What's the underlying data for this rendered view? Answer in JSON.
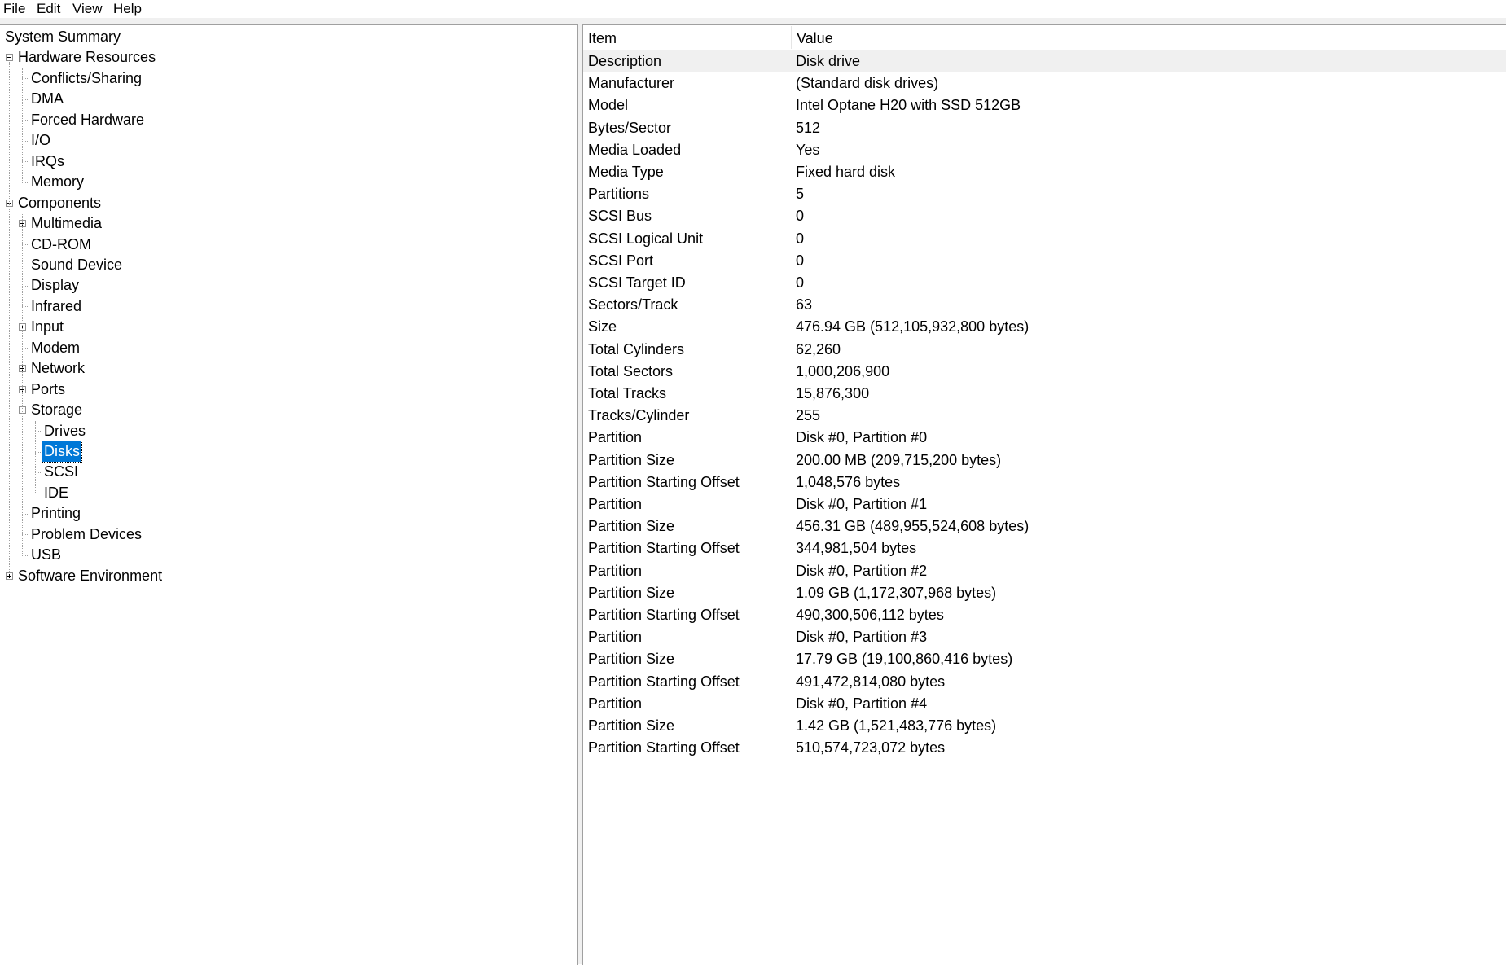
{
  "menu": [
    "File",
    "Edit",
    "View",
    "Help"
  ],
  "tree": [
    {
      "label": "System Summary",
      "level": 0,
      "expander": null
    },
    {
      "label": "Hardware Resources",
      "level": 1,
      "expander": "minus"
    },
    {
      "label": "Conflicts/Sharing",
      "level": 2,
      "expander": null
    },
    {
      "label": "DMA",
      "level": 2,
      "expander": null
    },
    {
      "label": "Forced Hardware",
      "level": 2,
      "expander": null
    },
    {
      "label": "I/O",
      "level": 2,
      "expander": null
    },
    {
      "label": "IRQs",
      "level": 2,
      "expander": null
    },
    {
      "label": "Memory",
      "level": 2,
      "expander": null
    },
    {
      "label": "Components",
      "level": 1,
      "expander": "minus"
    },
    {
      "label": "Multimedia",
      "level": 2,
      "expander": "plus"
    },
    {
      "label": "CD-ROM",
      "level": 2,
      "expander": null
    },
    {
      "label": "Sound Device",
      "level": 2,
      "expander": null
    },
    {
      "label": "Display",
      "level": 2,
      "expander": null
    },
    {
      "label": "Infrared",
      "level": 2,
      "expander": null
    },
    {
      "label": "Input",
      "level": 2,
      "expander": "plus"
    },
    {
      "label": "Modem",
      "level": 2,
      "expander": null
    },
    {
      "label": "Network",
      "level": 2,
      "expander": "plus"
    },
    {
      "label": "Ports",
      "level": 2,
      "expander": "plus"
    },
    {
      "label": "Storage",
      "level": 2,
      "expander": "minus"
    },
    {
      "label": "Drives",
      "level": 3,
      "expander": null
    },
    {
      "label": "Disks",
      "level": 3,
      "expander": null,
      "selected": true
    },
    {
      "label": "SCSI",
      "level": 3,
      "expander": null
    },
    {
      "label": "IDE",
      "level": 3,
      "expander": null
    },
    {
      "label": "Printing",
      "level": 2,
      "expander": null
    },
    {
      "label": "Problem Devices",
      "level": 2,
      "expander": null
    },
    {
      "label": "USB",
      "level": 2,
      "expander": null
    },
    {
      "label": "Software Environment",
      "level": 1,
      "expander": "plus"
    }
  ],
  "list": {
    "columns": [
      "Item",
      "Value"
    ],
    "rows": [
      [
        "Description",
        "Disk drive"
      ],
      [
        "Manufacturer",
        "(Standard disk drives)"
      ],
      [
        "Model",
        "Intel Optane H20 with SSD 512GB"
      ],
      [
        "Bytes/Sector",
        "512"
      ],
      [
        "Media Loaded",
        "Yes"
      ],
      [
        "Media Type",
        "Fixed hard disk"
      ],
      [
        "Partitions",
        "5"
      ],
      [
        "SCSI Bus",
        "0"
      ],
      [
        "SCSI Logical Unit",
        "0"
      ],
      [
        "SCSI Port",
        "0"
      ],
      [
        "SCSI Target ID",
        "0"
      ],
      [
        "Sectors/Track",
        "63"
      ],
      [
        "Size",
        "476.94 GB (512,105,932,800 bytes)"
      ],
      [
        "Total Cylinders",
        "62,260"
      ],
      [
        "Total Sectors",
        "1,000,206,900"
      ],
      [
        "Total Tracks",
        "15,876,300"
      ],
      [
        "Tracks/Cylinder",
        "255"
      ],
      [
        "Partition",
        "Disk #0, Partition #0"
      ],
      [
        "Partition Size",
        "200.00 MB (209,715,200 bytes)"
      ],
      [
        "Partition Starting Offset",
        "1,048,576 bytes"
      ],
      [
        "Partition",
        "Disk #0, Partition #1"
      ],
      [
        "Partition Size",
        "456.31 GB (489,955,524,608 bytes)"
      ],
      [
        "Partition Starting Offset",
        "344,981,504 bytes"
      ],
      [
        "Partition",
        "Disk #0, Partition #2"
      ],
      [
        "Partition Size",
        "1.09 GB (1,172,307,968 bytes)"
      ],
      [
        "Partition Starting Offset",
        "490,300,506,112 bytes"
      ],
      [
        "Partition",
        "Disk #0, Partition #3"
      ],
      [
        "Partition Size",
        "17.79 GB (19,100,860,416 bytes)"
      ],
      [
        "Partition Starting Offset",
        "491,472,814,080 bytes"
      ],
      [
        "Partition",
        "Disk #0, Partition #4"
      ],
      [
        "Partition Size",
        "1.42 GB (1,521,483,776 bytes)"
      ],
      [
        "Partition Starting Offset",
        "510,574,723,072 bytes"
      ]
    ],
    "highlighted_row": 0
  },
  "colors": {
    "selection": "#0078d7",
    "row_highlight": "#f0f0f0",
    "pane_border": "#a0a0a0"
  }
}
